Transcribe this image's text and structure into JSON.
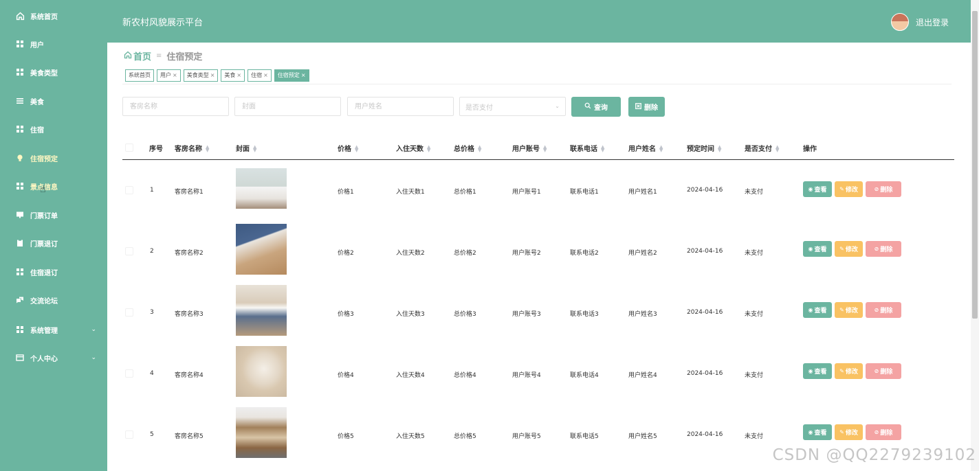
{
  "sidebar": {
    "items": [
      {
        "label": "系统首页",
        "icon": "home-icon"
      },
      {
        "label": "用户",
        "icon": "grid-icon"
      },
      {
        "label": "美食类型",
        "icon": "grid-icon"
      },
      {
        "label": "美食",
        "icon": "list-icon"
      },
      {
        "label": "住宿",
        "icon": "grid-icon"
      },
      {
        "label": "住宿预定",
        "icon": "bulb-icon"
      },
      {
        "label": "景点信息",
        "icon": "grid-icon"
      },
      {
        "label": "门票订单",
        "icon": "monitor-icon"
      },
      {
        "label": "门票退订",
        "icon": "clipboard-icon"
      },
      {
        "label": "住宿退订",
        "icon": "grid-icon"
      },
      {
        "label": "交流论坛",
        "icon": "chat-icon"
      },
      {
        "label": "系统管理",
        "icon": "grid-icon"
      },
      {
        "label": "个人中心",
        "icon": "user-card-icon"
      }
    ]
  },
  "header": {
    "title": "新农村风貌展示平台",
    "logout": "退出登录"
  },
  "breadcrumb": {
    "home": "首页",
    "current": "住宿预定"
  },
  "tags": [
    {
      "label": "系统首页"
    },
    {
      "label": "用户"
    },
    {
      "label": "美食类型"
    },
    {
      "label": "美食"
    },
    {
      "label": "住宿"
    },
    {
      "label": "住宿预定"
    }
  ],
  "search": {
    "room_placeholder": "客房名称",
    "cover_placeholder": "封面",
    "user_placeholder": "用户姓名",
    "paid_placeholder": "是否支付",
    "query_label": "查询",
    "delete_label": "删除"
  },
  "table": {
    "headers": {
      "index": "序号",
      "room": "客房名称",
      "cover": "封面",
      "price": "价格",
      "days": "入住天数",
      "total": "总价格",
      "account": "用户账号",
      "phone": "联系电话",
      "user": "用户姓名",
      "time": "预定时间",
      "paid": "是否支付",
      "ops": "操作"
    },
    "rows": [
      {
        "index": "1",
        "room": "客房名称1",
        "price": "价格1",
        "days": "入住天数1",
        "total": "总价格1",
        "account": "用户账号1",
        "phone": "联系电话1",
        "user": "用户姓名1",
        "time": "2024-04-16",
        "paid": "未支付"
      },
      {
        "index": "2",
        "room": "客房名称2",
        "price": "价格2",
        "days": "入住天数2",
        "total": "总价格2",
        "account": "用户账号2",
        "phone": "联系电话2",
        "user": "用户姓名2",
        "time": "2024-04-16",
        "paid": "未支付"
      },
      {
        "index": "3",
        "room": "客房名称3",
        "price": "价格3",
        "days": "入住天数3",
        "total": "总价格3",
        "account": "用户账号3",
        "phone": "联系电话3",
        "user": "用户姓名3",
        "time": "2024-04-16",
        "paid": "未支付"
      },
      {
        "index": "4",
        "room": "客房名称4",
        "price": "价格4",
        "days": "入住天数4",
        "total": "总价格4",
        "account": "用户账号4",
        "phone": "联系电话4",
        "user": "用户姓名4",
        "time": "2024-04-16",
        "paid": "未支付"
      },
      {
        "index": "5",
        "room": "客房名称5",
        "price": "价格5",
        "days": "入住天数5",
        "total": "总价格5",
        "account": "用户账号5",
        "phone": "联系电话5",
        "user": "用户姓名5",
        "time": "2024-04-16",
        "paid": "未支付"
      }
    ],
    "actions": {
      "view": "查看",
      "edit": "修改",
      "delete": "删除"
    }
  },
  "watermark": "CSDN @QQ2279239102",
  "colors": {
    "primary": "#6bb5a0",
    "edit": "#f9c263",
    "delete": "#f4a3a3"
  }
}
